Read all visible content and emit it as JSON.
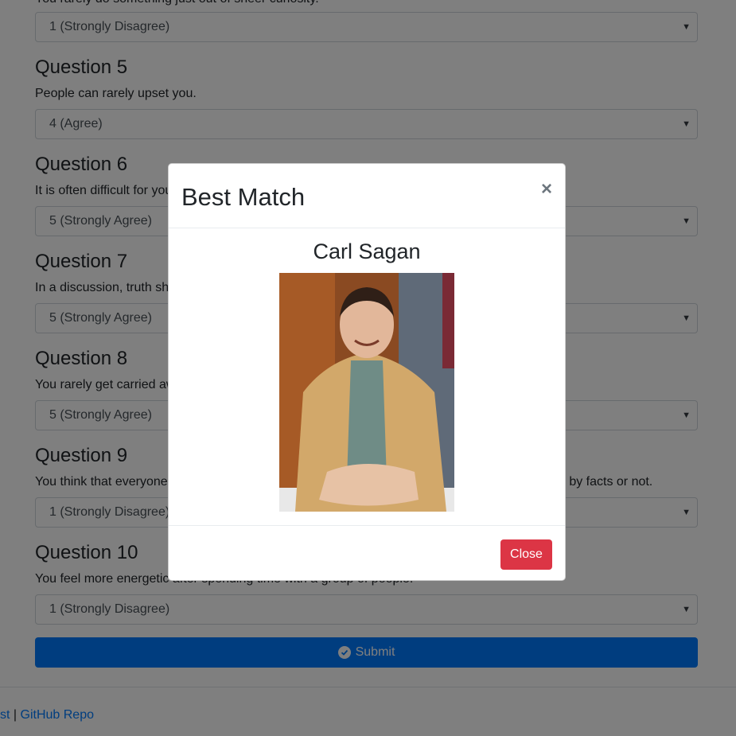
{
  "partial_question_text": "You rarely do something just out of sheer curiosity.",
  "questions": [
    {
      "title": "Question 5",
      "text": "People can rarely upset you."
    },
    {
      "title": "Question 6",
      "text": "It is often difficult for you to relate to other people's feelings."
    },
    {
      "title": "Question 7",
      "text": "In a discussion, truth should be more important than people's sensitivities."
    },
    {
      "title": "Question 8",
      "text": "You rarely get carried away by fantasies and ideas."
    },
    {
      "title": "Question 9",
      "text": "You think that everyone's views should be respected regardless of whether they are supported by facts or not."
    },
    {
      "title": "Question 10",
      "text": "You feel more energetic after spending time with a group of people."
    }
  ],
  "selects": [
    "1 (Strongly Disagree)",
    "4 (Agree)",
    "5 (Strongly Agree)",
    "5 (Strongly Agree)",
    "5 (Strongly Agree)",
    "1 (Strongly Disagree)",
    "1 (Strongly Disagree)"
  ],
  "submit_label": "Submit",
  "footer": {
    "link1": "st",
    "separator": " | ",
    "link2": "GitHub Repo"
  },
  "modal": {
    "title": "Best Match",
    "close_symbol": "×",
    "match_name": "Carl Sagan",
    "close_label": "Close"
  },
  "colors": {
    "primary": "#007bff",
    "danger": "#dc3545",
    "backdrop": "rgba(0,0,0,0.5)"
  }
}
